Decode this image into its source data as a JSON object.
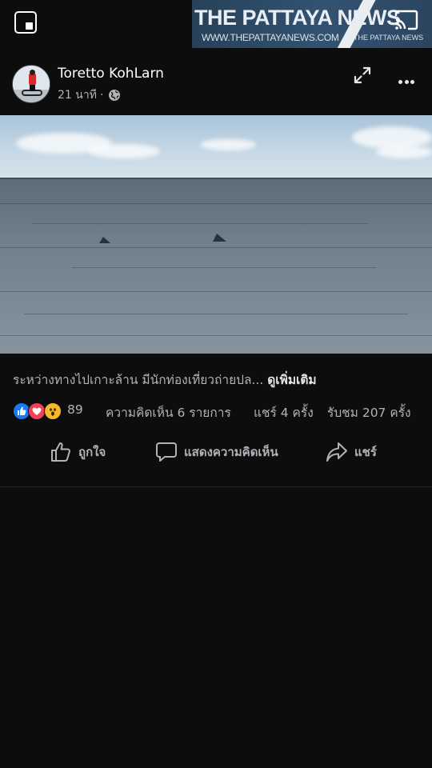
{
  "watermark": {
    "title": "THE PATTAYA NEWS",
    "url": "WWW.THEPATTAYANEWS.COM",
    "sub": "THE PATTAYA NEWS"
  },
  "post": {
    "author": "Toretto KohLarn",
    "time": "21 นาที",
    "separator": "·",
    "caption": "ระหว่างทางไปเกาะล้าน มีนักท่องเที่ยวถ่ายปล...",
    "see_more": "ดูเพิ่มเติม"
  },
  "stats": {
    "reaction_count": "89",
    "comments": "ความคิดเห็น 6 รายการ",
    "shares": "แชร์ 4 ครั้ง",
    "views": "รับชม 207 ครั้ง"
  },
  "actions": {
    "like": "ถูกใจ",
    "comment": "แสดงความคิดเห็น",
    "share": "แชร์"
  },
  "colors": {
    "background": "#0d0d0d",
    "like_blue": "#1877f2",
    "love_red": "#f33e58",
    "wow_yellow": "#f7b928"
  },
  "icons": [
    "pip-icon",
    "cast-icon",
    "expand-icon",
    "more-icon",
    "globe-icon",
    "like-icon",
    "comment-icon",
    "share-icon"
  ]
}
